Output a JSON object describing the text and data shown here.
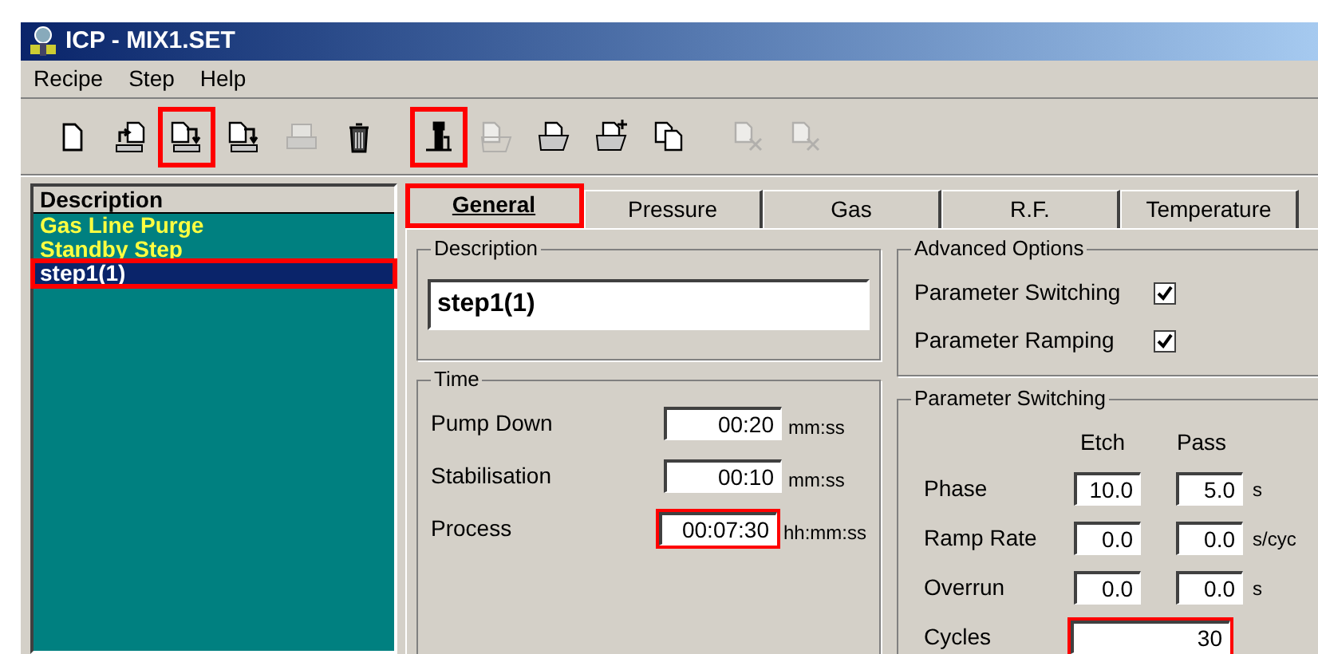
{
  "window": {
    "title": "ICP - MIX1.SET"
  },
  "menu": [
    "Recipe",
    "Step",
    "Help"
  ],
  "toolbar": [
    {
      "disabled": false,
      "highlighted": false
    },
    {
      "disabled": false,
      "highlighted": false
    },
    {
      "disabled": false,
      "highlighted": true
    },
    {
      "disabled": false,
      "highlighted": false
    },
    {
      "disabled": true,
      "highlighted": false
    },
    {
      "disabled": false,
      "highlighted": false
    },
    {
      "disabled": false,
      "highlighted": true
    },
    {
      "disabled": true,
      "highlighted": false
    },
    {
      "disabled": false,
      "highlighted": false
    },
    {
      "disabled": false,
      "highlighted": false
    },
    {
      "disabled": false,
      "highlighted": false
    },
    {
      "disabled": true,
      "highlighted": false
    },
    {
      "disabled": true,
      "highlighted": false
    }
  ],
  "steps": {
    "header": "Description",
    "items": [
      {
        "label": "Gas Line Purge",
        "selected": false,
        "highlighted": false
      },
      {
        "label": "Standby Step",
        "selected": false,
        "highlighted": false
      },
      {
        "label": "step1(1)",
        "selected": true,
        "highlighted": true
      }
    ]
  },
  "tabs": [
    {
      "label": "General",
      "selected": true,
      "highlighted": true
    },
    {
      "label": "Pressure",
      "selected": false,
      "highlighted": false
    },
    {
      "label": "Gas",
      "selected": false,
      "highlighted": false
    },
    {
      "label": "R.F.",
      "selected": false,
      "highlighted": false
    },
    {
      "label": "Temperature",
      "selected": false,
      "highlighted": false
    }
  ],
  "description": {
    "title": "Description",
    "value": "step1(1)"
  },
  "time": {
    "title": "Time",
    "rows": [
      {
        "label": "Pump Down",
        "value": "00:20",
        "unit": "mm:ss",
        "highlighted": false
      },
      {
        "label": "Stabilisation",
        "value": "00:10",
        "unit": "mm:ss",
        "highlighted": false
      },
      {
        "label": "Process",
        "value": "00:07:30",
        "unit": "hh:mm:ss",
        "highlighted": true
      }
    ]
  },
  "advanced_options": {
    "title": "Advanced Options",
    "options": [
      {
        "label": "Parameter Switching",
        "checked": true
      },
      {
        "label": "Parameter Ramping",
        "checked": true
      }
    ]
  },
  "parameter_switching": {
    "title": "Parameter Switching",
    "columns": [
      "Etch",
      "Pass"
    ],
    "rows": [
      {
        "label": "Phase",
        "etch": "10.0",
        "pass": "5.0",
        "unit": "s"
      },
      {
        "label": "Ramp Rate",
        "etch": "0.0",
        "pass": "0.0",
        "unit": "s/cyc"
      },
      {
        "label": "Overrun",
        "etch": "0.0",
        "pass": "0.0",
        "unit": "s"
      }
    ],
    "cycles": {
      "label": "Cycles",
      "value": "30",
      "highlighted": true
    }
  }
}
